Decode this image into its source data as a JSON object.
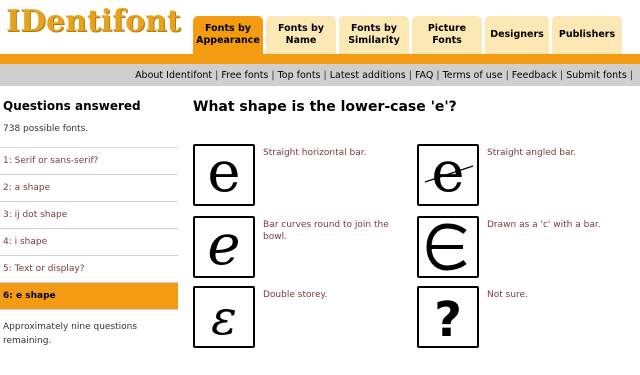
{
  "logo": {
    "text": "IDentifont"
  },
  "tabs": [
    {
      "label": "Fonts by Appearance",
      "active": true
    },
    {
      "label": "Fonts by Name",
      "active": false
    },
    {
      "label": "Fonts by Similarity",
      "active": false
    },
    {
      "label": "Picture Fonts",
      "active": false
    },
    {
      "label": "Designers",
      "active": false
    },
    {
      "label": "Publishers",
      "active": false
    }
  ],
  "nav": [
    "About Identifont",
    "Free fonts",
    "Top fonts",
    "Latest additions",
    "FAQ",
    "Terms of use",
    "Feedback",
    "Submit fonts"
  ],
  "sidebar": {
    "title": "Questions answered",
    "count": "738 possible fonts.",
    "items": [
      {
        "label": "1: Serif or sans-serif?",
        "active": false
      },
      {
        "label": "2: a shape",
        "active": false
      },
      {
        "label": "3: ij dot shape",
        "active": false
      },
      {
        "label": "4: i shape",
        "active": false
      },
      {
        "label": "5: Text or display?",
        "active": false
      },
      {
        "label": "6: e shape",
        "active": true
      }
    ],
    "note": "Approximately nine questions remaining."
  },
  "main": {
    "question": "What shape is the lower-case 'e'?",
    "options": [
      {
        "text": "Straight horizontal bar.",
        "icon": "e-straight-bar-icon"
      },
      {
        "text": "Straight angled bar.",
        "icon": "e-angled-bar-icon"
      },
      {
        "text": "Bar curves round to join the bowl.",
        "icon": "e-curved-bar-icon"
      },
      {
        "text": "Drawn as a 'c' with a bar.",
        "icon": "e-c-with-bar-icon"
      },
      {
        "text": "Double storey.",
        "icon": "e-double-storey-icon"
      },
      {
        "text": "Not sure.",
        "icon": "question-mark-icon"
      }
    ]
  },
  "colors": {
    "accent": "#f39c12",
    "tab_bg": "#fbe8b5",
    "navbar": "#cfcfcf",
    "link": "#7a3a3a"
  }
}
